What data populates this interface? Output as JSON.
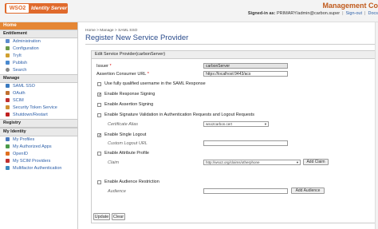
{
  "header": {
    "logo_mark": "WSO2",
    "logo_text": "Identity Server",
    "management": "Management Co",
    "signed_in_label": "Signed-in as:",
    "user": "PRIMARY/admin@carbon.super",
    "sign_out": "Sign-out",
    "docs": "Docs"
  },
  "sidebar": {
    "home": "Home",
    "sections": [
      {
        "title": "Entitlement",
        "items": [
          {
            "label": "Administration",
            "icon": "admin-icon",
            "color": "#5b8bd0"
          },
          {
            "label": "Configuration",
            "icon": "config-icon",
            "color": "#6a9a4a"
          },
          {
            "label": "TryIt",
            "icon": "tryit-icon",
            "color": "#d0a030"
          },
          {
            "label": "Publish",
            "icon": "publish-icon",
            "color": "#4a8ad0"
          },
          {
            "label": "Search",
            "icon": "search-icon",
            "color": "#888888"
          }
        ]
      },
      {
        "title": "Manage",
        "items": [
          {
            "label": "SAML SSO",
            "icon": "saml-icon",
            "color": "#3a7ac0"
          },
          {
            "label": "OAuth",
            "icon": "oauth-icon",
            "color": "#c07030"
          },
          {
            "label": "SCIM",
            "icon": "scim-icon",
            "color": "#c03030"
          },
          {
            "label": "Security Token Service",
            "icon": "sts-icon",
            "color": "#d09030"
          },
          {
            "label": "Shutdown/Restart",
            "icon": "shutdown-icon",
            "color": "#c02020"
          }
        ]
      },
      {
        "title": "Registry",
        "items": []
      },
      {
        "title": "My Identity",
        "items": [
          {
            "label": "My Profiles",
            "icon": "profile-icon",
            "color": "#4a7ac0"
          },
          {
            "label": "My Authorized Apps",
            "icon": "apps-icon",
            "color": "#4a9a4a"
          },
          {
            "label": "OpenID",
            "icon": "openid-icon",
            "color": "#e07020"
          },
          {
            "label": "My SCIM Providers",
            "icon": "scim-provider-icon",
            "color": "#c03030"
          },
          {
            "label": "Multifactor Authentication",
            "icon": "mfa-icon",
            "color": "#3a8ac0"
          }
        ]
      }
    ]
  },
  "breadcrumb": "Home > Manage > SAML SSO",
  "page_title": "Register New Service Provider",
  "panel": {
    "heading": "Edit Service Provider(carbonServer)",
    "issuer_label": "Issuer",
    "issuer_value": "carbonServer",
    "acs_label": "Assertion Consumer URL",
    "acs_value": "https://localhost:9443/acs",
    "use_fq_username": "Use fully qualified username in the SAML Response",
    "enable_response_signing": "Enable Response Signing",
    "enable_assertion_signing": "Enable Assertion Signing",
    "enable_signature_validation": "Enable Signature Validation in Authentication Requests and Logout Requests",
    "certificate_alias_label": "Certificate Alias",
    "certificate_alias_value": "wso2carbon.cert",
    "enable_single_logout": "Enable Single Logout",
    "custom_logout_url_label": "Custom Logout URL",
    "enable_attribute_profile": "Enable Attribute Profile",
    "claim_label": "Claim",
    "claim_value": "http://wso2.org/claims/otherphone",
    "add_claim": "Add Claim",
    "enable_audience_restriction": "Enable Audience Restriction",
    "audience_label": "Audience",
    "add_audience": "Add Audience"
  },
  "buttons": {
    "update": "Update",
    "clear": "Clear"
  },
  "checkboxes": {
    "use_fq_username": false,
    "enable_response_signing": true,
    "enable_assertion_signing": false,
    "enable_signature_validation": false,
    "enable_single_logout": true,
    "enable_attribute_profile": false,
    "enable_audience_restriction": false
  },
  "colors": {
    "accent": "#e58634",
    "title": "#2b4c8c",
    "link": "#2b5ea8"
  }
}
